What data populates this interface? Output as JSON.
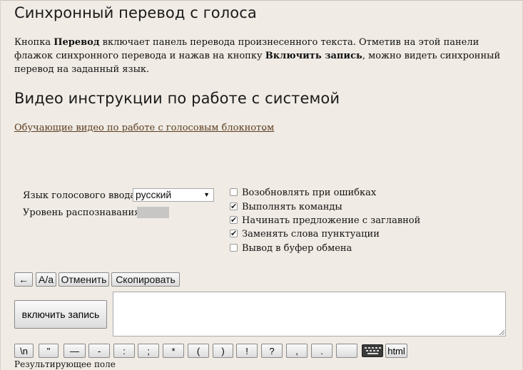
{
  "section1": {
    "title": "Синхронный перевод с голоса",
    "para_part1": "Кнопка ",
    "para_bold1": "Перевод",
    "para_part2": " включает панель перевода произнесенного текста. Отметив на этой панели флажок синхронного перевода и нажав на кнопку ",
    "para_bold2": "Включить запись",
    "para_part3": ", можно видеть синхронный перевод на заданный язык."
  },
  "section2": {
    "title": "Видео инструкции по работе с системой",
    "link_text": "Обучающие видео по работе с голосовым блокнотом",
    "link_suffix": "."
  },
  "controls": {
    "lang_label": "Язык голосового ввода",
    "lang_value": "русский",
    "level_label": "Уровень распознавания",
    "level_value": 0,
    "options": [
      {
        "label": "Возобновлять при ошибках",
        "checked": false
      },
      {
        "label": "Выполнять команды",
        "checked": true
      },
      {
        "label": "Начинать предложение с заглавной",
        "checked": true
      },
      {
        "label": "Заменять слова пунктуации",
        "checked": true
      },
      {
        "label": "Вывод в буфер обмена",
        "checked": false
      }
    ]
  },
  "toolbar": {
    "back_label": "←",
    "case_label": "A/a",
    "undo_label": "Отменить",
    "copy_label": "Скопировать"
  },
  "record_button": "включить запись",
  "textarea_value": "",
  "symbols": [
    "\\n",
    "\"",
    "—",
    "-",
    ":",
    ";",
    "*",
    "(",
    ")",
    "!",
    "?",
    ",",
    ".",
    " "
  ],
  "keyboard_icon": "keyboard-icon",
  "html_button": "html",
  "result_label": "Результирующее поле"
}
